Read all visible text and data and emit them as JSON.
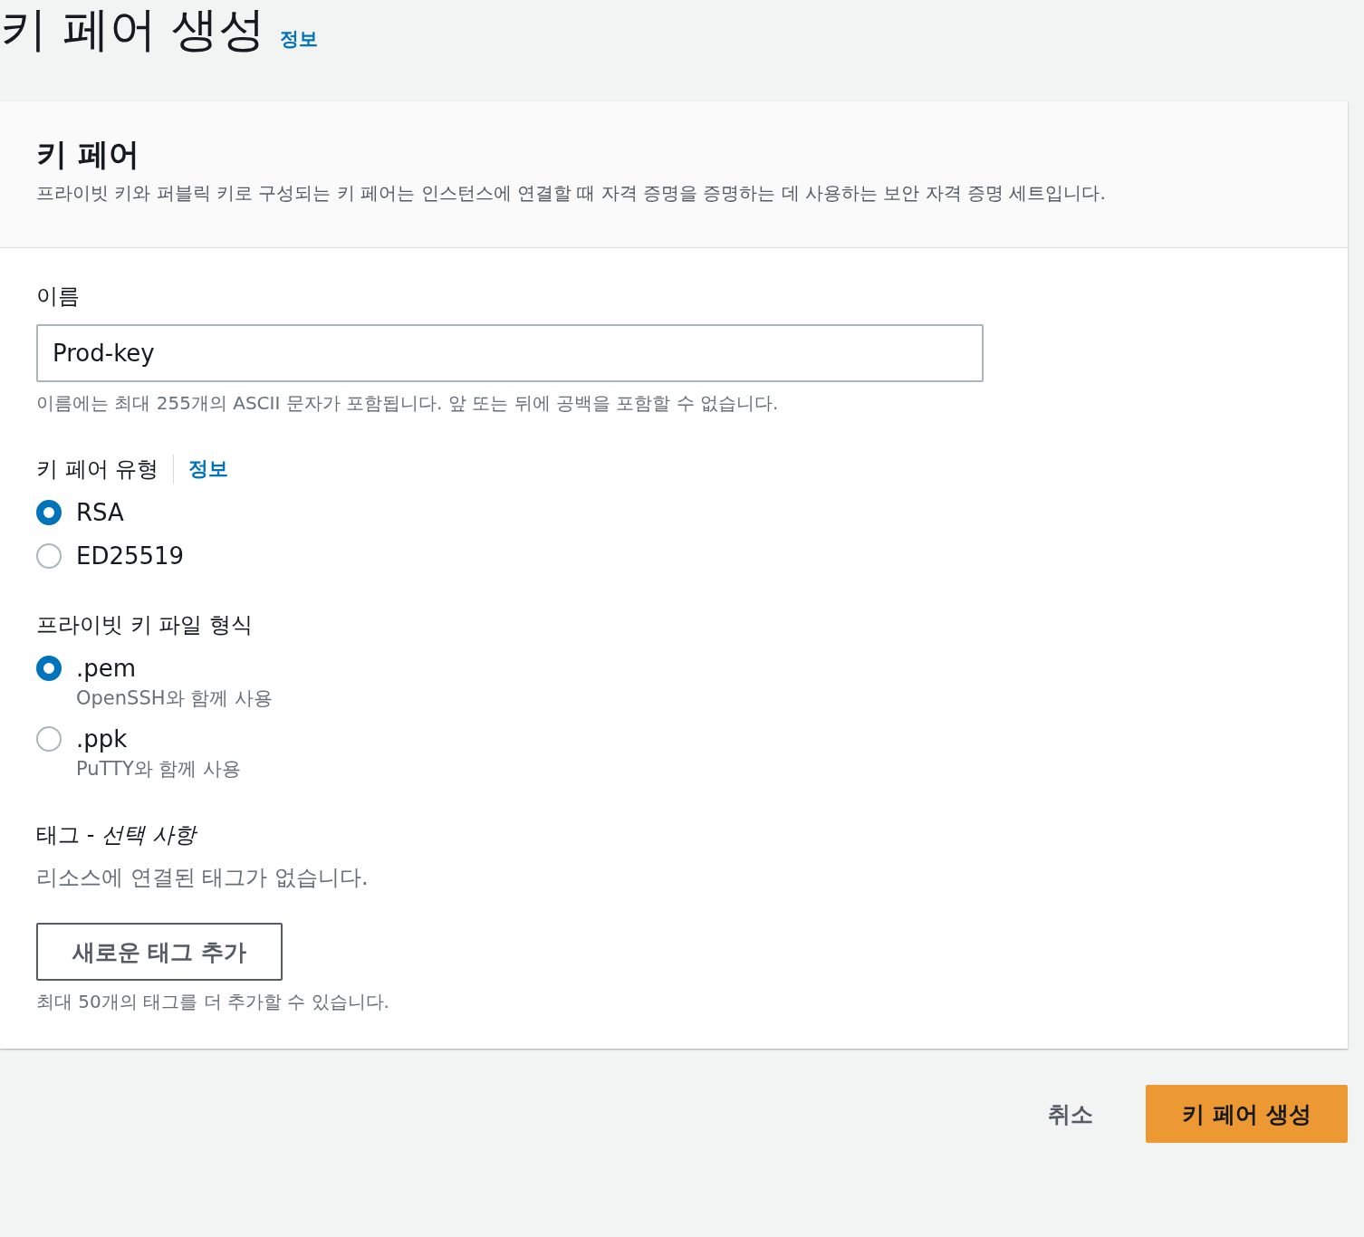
{
  "page": {
    "title": "키 페어 생성",
    "info_link": "정보"
  },
  "panel": {
    "heading": "키 페어",
    "description": "프라이빗 키와 퍼블릭 키로 구성되는 키 페어는 인스턴스에 연결할 때 자격 증명을 증명하는 데 사용하는 보안 자격 증명 세트입니다."
  },
  "name_field": {
    "label": "이름",
    "value": "Prod-key",
    "hint": "이름에는 최대 255개의 ASCII 문자가 포함됩니다. 앞 또는 뒤에 공백을 포함할 수 없습니다."
  },
  "key_type": {
    "label": "키 페어 유형",
    "info_link": "정보",
    "options": [
      {
        "label": "RSA",
        "selected": true
      },
      {
        "label": "ED25519",
        "selected": false
      }
    ]
  },
  "file_format": {
    "label": "프라이빗 키 파일 형식",
    "options": [
      {
        "label": ".pem",
        "description": "OpenSSH와 함께 사용",
        "selected": true
      },
      {
        "label": ".ppk",
        "description": "PuTTY와 함께 사용",
        "selected": false
      }
    ]
  },
  "tags": {
    "label": "태그 - *선택 사항*",
    "empty_message": "리소스에 연결된 태그가 없습니다.",
    "add_button": "새로운 태그 추가",
    "limit_note": "최대 50개의 태그를 더 추가할 수 있습니다."
  },
  "actions": {
    "cancel": "취소",
    "submit": "키 페어 생성"
  }
}
